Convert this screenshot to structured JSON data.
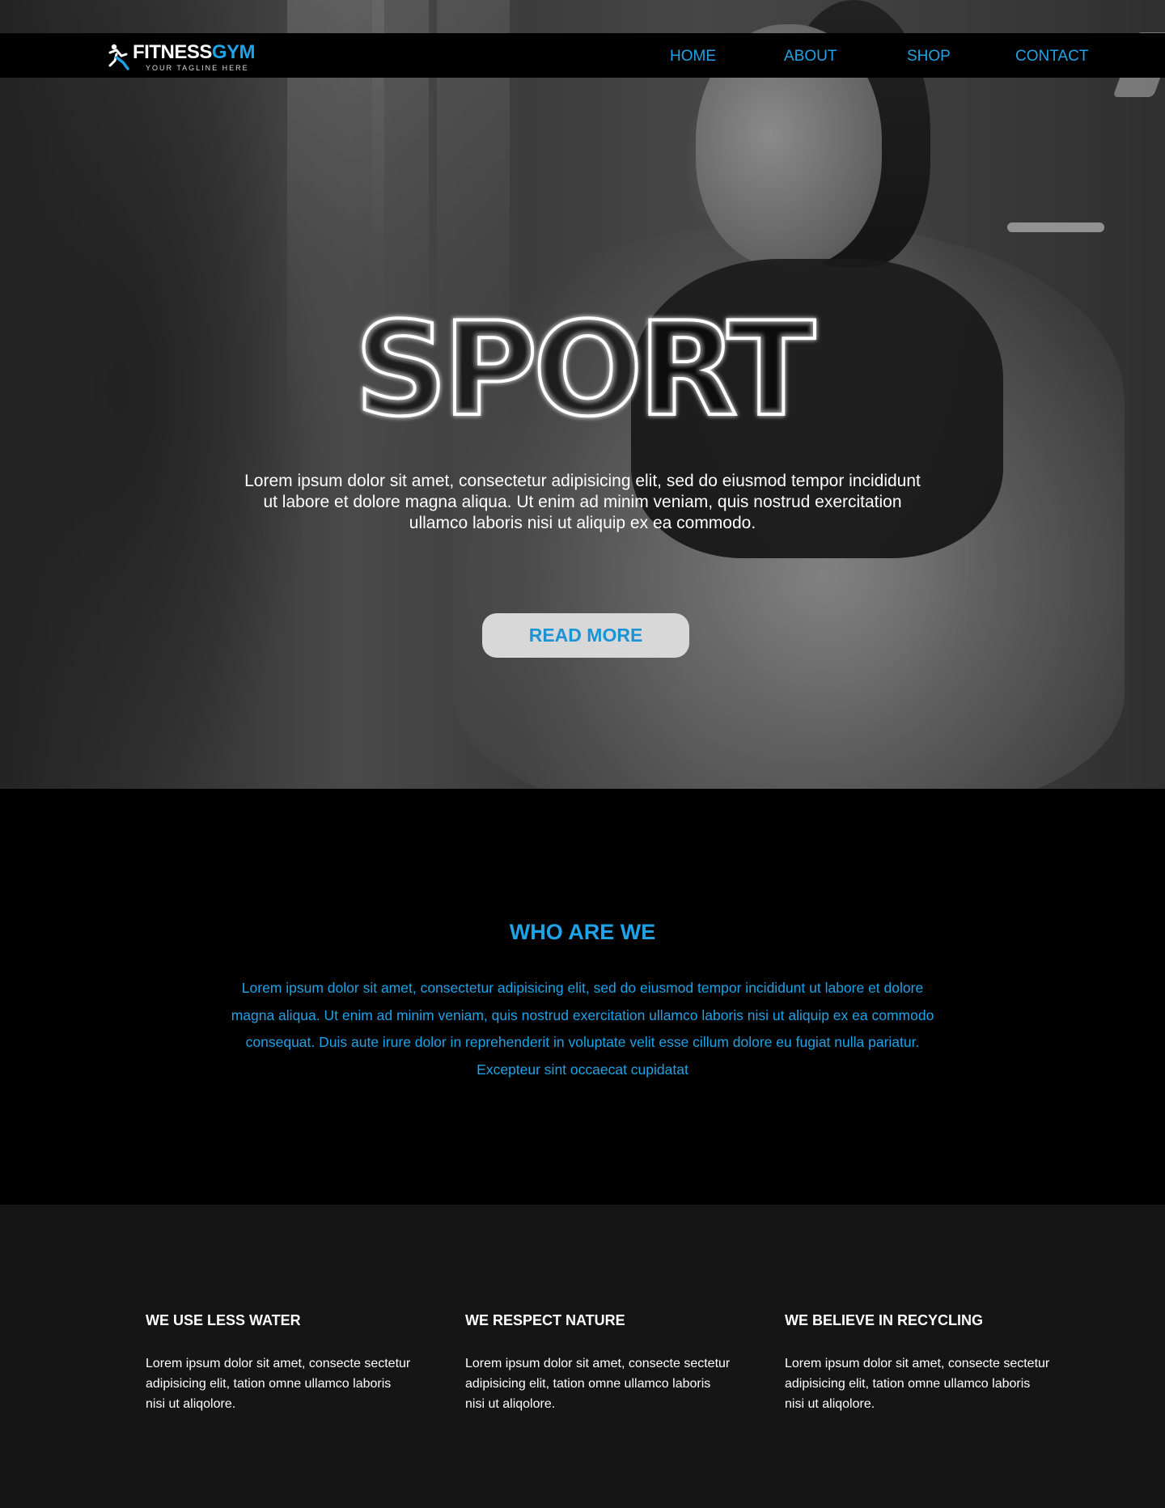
{
  "brand": {
    "name_part1": "FITNESS",
    "name_part2": "GYM",
    "tagline": "YOUR TAGLINE HERE",
    "accent_color": "#1ea3e6"
  },
  "nav": {
    "items": [
      {
        "label": "HOME"
      },
      {
        "label": "ABOUT"
      },
      {
        "label": "SHOP"
      },
      {
        "label": "CONTACT"
      }
    ]
  },
  "hero": {
    "title": "SPORT",
    "body": "Lorem ipsum dolor sit amet, consectetur adipisicing elit, sed do eiusmod tempor incididunt ut labore et dolore magna aliqua. Ut enim ad minim veniam, quis nostrud exercitation ullamco laboris nisi ut aliquip ex ea commodo.",
    "cta_label": "READ MORE"
  },
  "about": {
    "title": "WHO ARE WE",
    "body": "Lorem ipsum dolor sit amet, consectetur adipisicing elit, sed do eiusmod tempor incididunt ut labore et dolore magna aliqua. Ut enim ad minim veniam, quis nostrud exercitation ullamco laboris nisi ut aliquip ex ea commodo consequat. Duis aute irure dolor in reprehenderit in voluptate velit esse cillum dolore eu fugiat nulla pariatur. Excepteur sint occaecat cupidatat"
  },
  "features": [
    {
      "title": "WE USE LESS WATER",
      "body": "Lorem ipsum dolor sit amet, consecte sectetur adipisicing elit, tation omne ullamco laboris nisi ut aliqolore."
    },
    {
      "title": "WE RESPECT NATURE",
      "body": "Lorem ipsum dolor sit amet, consecte sectetur adipisicing elit, tation omne ullamco laboris nisi ut aliqolore."
    },
    {
      "title": "WE BELIEVE IN RECYCLING",
      "body": "Lorem ipsum dolor sit amet, consecte sectetur adipisicing elit, tation omne ullamco laboris nisi ut aliqolore."
    }
  ],
  "icons": {
    "logo": "running-figure-icon"
  }
}
